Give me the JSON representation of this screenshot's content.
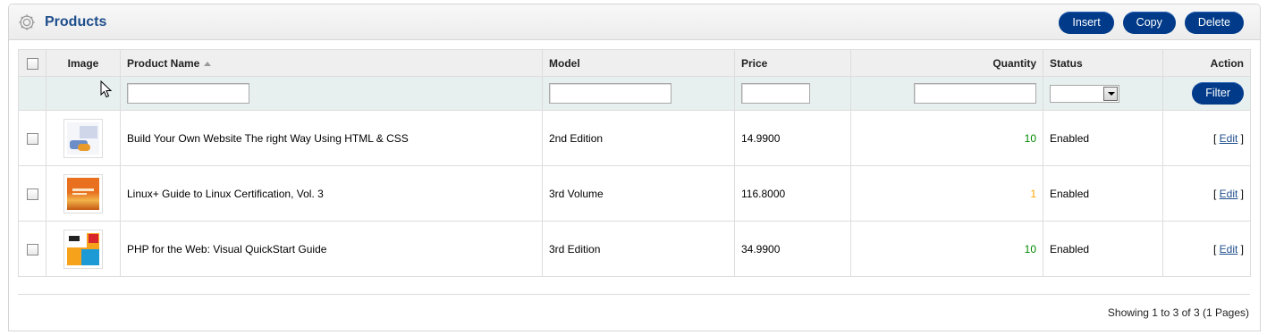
{
  "header": {
    "title": "Products",
    "buttons": {
      "insert": "Insert",
      "copy": "Copy",
      "delete": "Delete"
    }
  },
  "columns": {
    "image": "Image",
    "name": "Product Name",
    "model": "Model",
    "price": "Price",
    "quantity": "Quantity",
    "status": "Status",
    "action": "Action"
  },
  "filter": {
    "button": "Filter"
  },
  "products": [
    {
      "name": "Build Your Own Website The right Way Using HTML & CSS",
      "model": "2nd Edition",
      "price": "14.9900",
      "quantity": "10",
      "status": "Enabled",
      "action_open": "[ ",
      "action_label": "Edit",
      "action_close": " ]"
    },
    {
      "name": "Linux+ Guide to Linux Certification, Vol. 3",
      "model": "3rd Volume",
      "price": "116.8000",
      "quantity": "1",
      "status": "Enabled",
      "action_open": "[ ",
      "action_label": "Edit",
      "action_close": " ]"
    },
    {
      "name": "PHP for the Web: Visual QuickStart Guide",
      "model": "3rd Edition",
      "price": "34.9900",
      "quantity": "10",
      "status": "Enabled",
      "action_open": "[ ",
      "action_label": "Edit",
      "action_close": " ]"
    }
  ],
  "pagination": {
    "text": "Showing 1 to 3 of 3 (1 Pages)"
  },
  "colors": {
    "brand": "#1e4e8c",
    "button": "#003a88",
    "qty_ok": "#008800",
    "qty_low": "#ffa500"
  },
  "icons": {
    "heading": "gear-icon",
    "sort": "sort-ascending-icon",
    "select": "chevron-down-icon",
    "cursor": "mouse-pointer-icon"
  }
}
